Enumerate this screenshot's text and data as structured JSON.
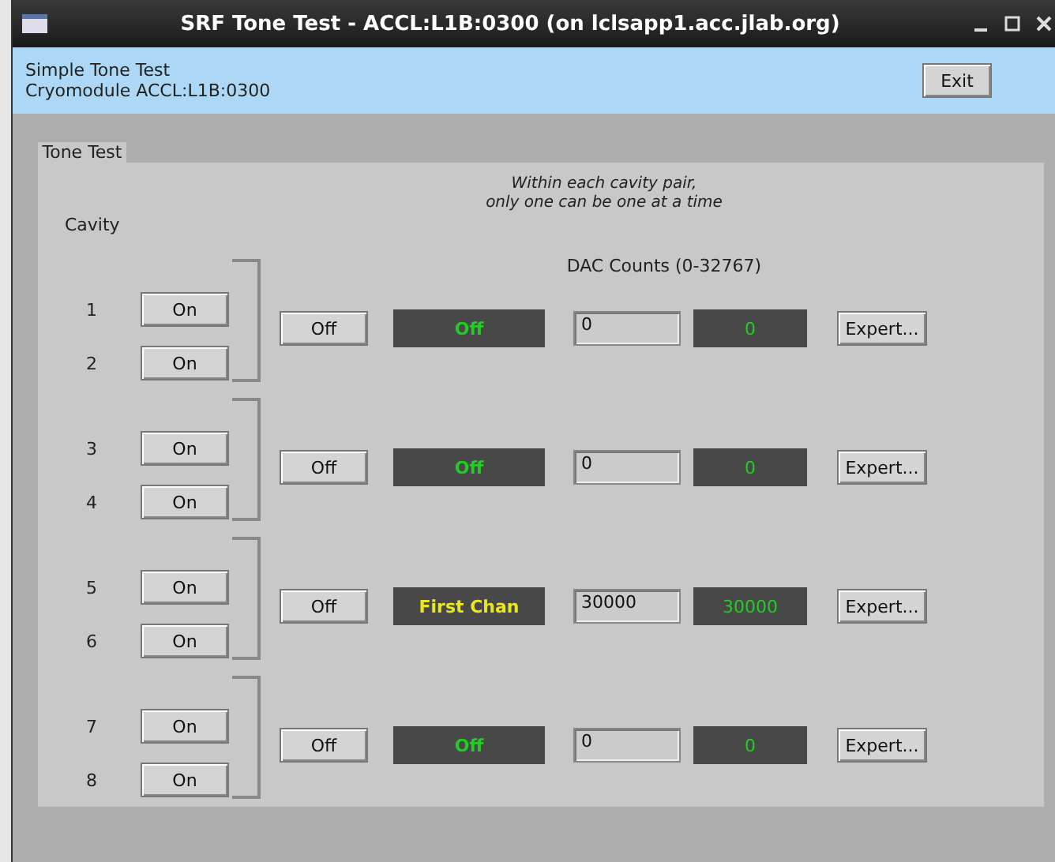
{
  "window": {
    "title": "SRF Tone Test - ACCL:L1B:0300 (on lclsapp1.acc.jlab.org)"
  },
  "header": {
    "lines": [
      "Simple Tone Test",
      "Cryomodule ACCL:L1B:0300"
    ],
    "exit_button": "Exit"
  },
  "tabs": [
    {
      "label": "Tone Test",
      "selected": true
    }
  ],
  "panel": {
    "note": [
      "Within each cavity pair,",
      "only one can be one at a time"
    ],
    "cavity_heading": "Cavity",
    "dac_heading": "DAC Counts (0-32767)",
    "pairs": [
      {
        "cavities": [
          {
            "number": "1",
            "button": "On"
          },
          {
            "number": "2",
            "button": "On"
          }
        ],
        "off_button": "Off",
        "status": {
          "text": "Off",
          "color": "#22cc22"
        },
        "dac_value": "0",
        "readback": "0",
        "expert_button": "Expert..."
      },
      {
        "cavities": [
          {
            "number": "3",
            "button": "On"
          },
          {
            "number": "4",
            "button": "On"
          }
        ],
        "off_button": "Off",
        "status": {
          "text": "Off",
          "color": "#22cc22"
        },
        "dac_value": "0",
        "readback": "0",
        "expert_button": "Expert..."
      },
      {
        "cavities": [
          {
            "number": "5",
            "button": "On"
          },
          {
            "number": "6",
            "button": "On"
          }
        ],
        "off_button": "Off",
        "status": {
          "text": "First Chan",
          "color": "#e8e820"
        },
        "dac_value": "30000",
        "readback": "30000",
        "expert_button": "Expert..."
      },
      {
        "cavities": [
          {
            "number": "7",
            "button": "On"
          },
          {
            "number": "8",
            "button": "On"
          }
        ],
        "off_button": "Off",
        "status": {
          "text": "Off",
          "color": "#22cc22"
        },
        "dac_value": "0",
        "readback": "0",
        "expert_button": "Expert..."
      }
    ]
  }
}
